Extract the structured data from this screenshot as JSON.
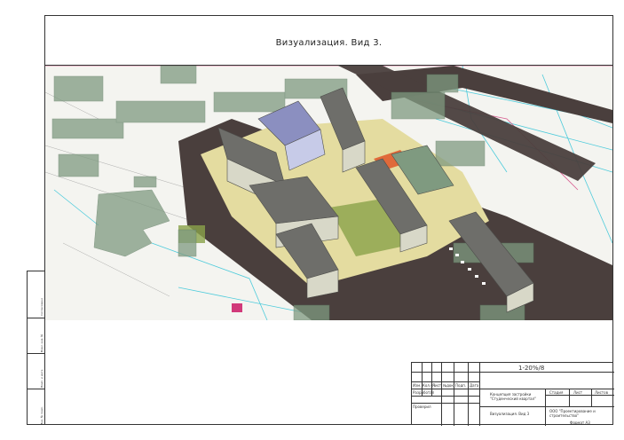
{
  "sheet": {
    "title": "Визуализация. Вид 3."
  },
  "stamp": {
    "code": "1-20%/8",
    "project_name": "Концепция застройки \"Студенческий квартал\"",
    "sheet_name": "Визуализация. Вид 3",
    "org": "ООО \"Проектирование и строительство\"",
    "format": "Формат А3",
    "col_stage": "Стадия",
    "col_sheet": "Лист",
    "col_sheets": "Листов",
    "roles": [
      "Изм.",
      "Кол.уч",
      "Лист",
      "№док",
      "Подп.",
      "Дата"
    ],
    "developer_label": "Разработал",
    "checker_label": "Проверил"
  },
  "left_strip": {
    "labels": [
      "Согласовано",
      "Взам. инв. №",
      "Подп. и дата",
      "Инв. № подл."
    ]
  },
  "colors": {
    "ground": "#f2f2ee",
    "road": "#4a3f3d",
    "plaza": "#e4dca0",
    "roof": "#6e6e6a",
    "ghost": "#7f9a80",
    "cad_blue": "#3cc7d9",
    "cad_magenta": "#d13a7a",
    "court_orange": "#e06a3a"
  }
}
